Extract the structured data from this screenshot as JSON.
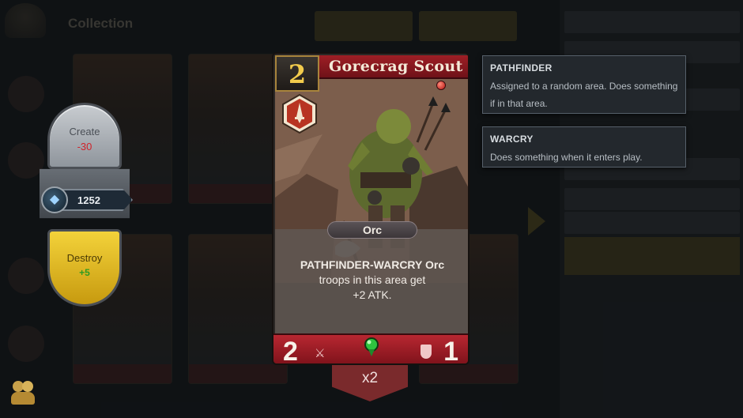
{
  "background": {
    "screen_title": "Collection"
  },
  "craft_panel": {
    "create_label": "Create",
    "create_cost": "-30",
    "shard_count": "1252",
    "destroy_label": "Destroy",
    "destroy_gain": "+5"
  },
  "card": {
    "cost": "2",
    "name": "Gorecrag Scout",
    "tribe": "Orc",
    "text_keywords": "PATHFINDER-WARCRY Orc",
    "text_body": "troops in this area get +2 ATK.",
    "attack": "2",
    "health": "1",
    "copies": "x2",
    "frame_color": "#9e1e25",
    "cost_color": "#f2cb4c"
  },
  "keywords": [
    {
      "title": "PATHFINDER",
      "description": "Assigned to a random area.  Does something if in that area."
    },
    {
      "title": "WARCRY",
      "description": "Does something when it enters play."
    }
  ],
  "icons": [
    "crafting-shard-icon",
    "sword-icon",
    "shield-icon",
    "rarity-gem-icon",
    "faction-gem-icon",
    "class-badge-icon",
    "characters-icon"
  ]
}
